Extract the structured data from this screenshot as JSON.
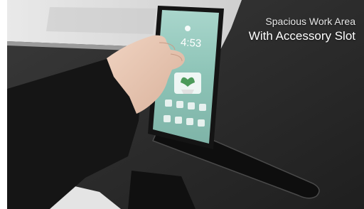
{
  "caption": {
    "line1": "Spacious Work Area",
    "line2": "With Accessory Slot"
  },
  "phone": {
    "clock": "4:53"
  },
  "colors": {
    "desk": "#2b2b2b",
    "laptop": "#dcdcdc",
    "sleeve": "#161616",
    "skin": "#e8c8b4",
    "phone_screen": "#8fc4b8"
  }
}
